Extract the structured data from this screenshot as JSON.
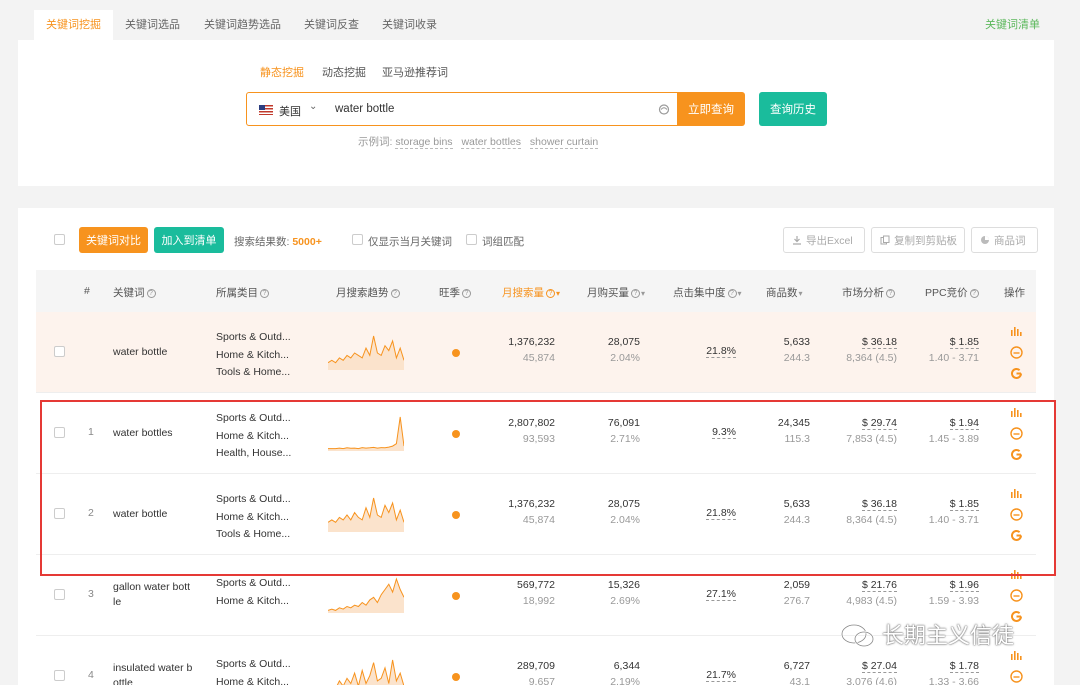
{
  "top_tabs": [
    "关键词挖掘",
    "关键词选品",
    "关键词趋势选品",
    "关键词反查",
    "关键词收录"
  ],
  "keyword_list_link": "关键词清单",
  "search": {
    "mode_tabs": [
      "静态挖掘",
      "动态挖掘",
      "亚马逊推荐词"
    ],
    "country": "美国",
    "query": "water bottle",
    "query_button": "立即查询",
    "history_button": "查询历史",
    "examples_label": "示例词:",
    "examples": [
      "storage bins",
      "water bottles",
      "shower curtain"
    ]
  },
  "toolbar": {
    "compare_button": "关键词对比",
    "add_list_button": "加入到清单",
    "result_label": "搜索结果数:",
    "result_count": "5000+",
    "option_current_month": "仅显示当月关键词",
    "option_phrase_match": "词组匹配",
    "export_excel": "导出Excel",
    "copy_clipboard": "复制到剪贴板",
    "product_words": "商品词"
  },
  "columns": {
    "index": "#",
    "keyword": "关键词",
    "category": "所属类目",
    "trend": "月搜索趋势",
    "wangshou": "旺季",
    "monthly_search": "月搜索量",
    "monthly_purchase": "月购买量",
    "click_concentration": "点击集中度",
    "product_count": "商品数",
    "market_analysis": "市场分析",
    "ppc_bid": "PPC竞价",
    "actions": "操作"
  },
  "rows": [
    {
      "index": "",
      "keyword": "water bottle",
      "categories": [
        "Sports & Outd...",
        "Home & Kitch...",
        "Tools & Home..."
      ],
      "search": "1,376,232",
      "search_sub": "45,874",
      "purchase": "28,075",
      "purchase_sub": "2.04%",
      "click": "21.8%",
      "products": "5,633",
      "products_sub": "244.3",
      "price": "$ 36.18",
      "rating": "8,364 (4.5)",
      "ppc": "$ 1.85",
      "ppc_range": "1.40 - 3.71",
      "trend": [
        3,
        4,
        3,
        5,
        4,
        6,
        5,
        7,
        6,
        5,
        9,
        6,
        14,
        7,
        6,
        10,
        8,
        12,
        5,
        9,
        4
      ]
    },
    {
      "index": "1",
      "keyword": "water bottles",
      "categories": [
        "Sports & Outd...",
        "Home & Kitch...",
        "Health, House..."
      ],
      "search": "2,807,802",
      "search_sub": "93,593",
      "purchase": "76,091",
      "purchase_sub": "2.71%",
      "click": "9.3%",
      "products": "24,345",
      "products_sub": "115.3",
      "price": "$ 29.74",
      "rating": "7,853 (4.5)",
      "ppc": "$ 1.94",
      "ppc_range": "1.45 - 3.89",
      "trend": [
        1,
        1,
        1,
        1.2,
        1,
        1.3,
        1.1,
        1.2,
        1,
        1.4,
        1.2,
        1.3,
        1.5,
        1.2,
        1.4,
        1.3,
        1.6,
        2,
        3,
        14,
        2
      ]
    },
    {
      "index": "2",
      "keyword": "water bottle",
      "categories": [
        "Sports & Outd...",
        "Home & Kitch...",
        "Tools & Home..."
      ],
      "search": "1,376,232",
      "search_sub": "45,874",
      "purchase": "28,075",
      "purchase_sub": "2.04%",
      "click": "21.8%",
      "products": "5,633",
      "products_sub": "244.3",
      "price": "$ 36.18",
      "rating": "8,364 (4.5)",
      "ppc": "$ 1.85",
      "ppc_range": "1.40 - 3.71",
      "trend": [
        4,
        5,
        4,
        6,
        5,
        7,
        5,
        8,
        6,
        5,
        10,
        6,
        14,
        7,
        6,
        11,
        8,
        12,
        5,
        9,
        4
      ]
    },
    {
      "index": "3",
      "keyword": "gallon water bott\nle",
      "categories": [
        "Sports & Outd...",
        "Home & Kitch..."
      ],
      "search": "569,772",
      "search_sub": "18,992",
      "purchase": "15,326",
      "purchase_sub": "2.69%",
      "click": "27.1%",
      "products": "2,059",
      "products_sub": "276.7",
      "price": "$ 21.76",
      "rating": "4,983 (4.5)",
      "ppc": "$ 1.96",
      "ppc_range": "1.59 - 3.93",
      "trend": [
        1,
        1.5,
        1,
        2,
        1.5,
        2.5,
        2,
        3,
        2.5,
        4,
        3,
        5,
        6,
        4,
        7,
        9,
        11,
        8,
        13,
        9,
        6
      ]
    },
    {
      "index": "4",
      "keyword": "insulated water b\nottle",
      "categories": [
        "Sports & Outd...",
        "Home & Kitch..."
      ],
      "search": "289,709",
      "search_sub": "9,657",
      "purchase": "6,344",
      "purchase_sub": "2.19%",
      "click": "21.7%",
      "products": "6,727",
      "products_sub": "43.1",
      "price": "$ 27.04",
      "rating": "3,076 (4.6)",
      "ppc": "$ 1.78",
      "ppc_range": "1.33 - 3.66",
      "trend": [
        2,
        3,
        2,
        5,
        3,
        6,
        4,
        8,
        3,
        9,
        4,
        7,
        12,
        5,
        6,
        10,
        4,
        13,
        5,
        8,
        3
      ]
    }
  ],
  "watermark": "长期主义信徒",
  "colors": {
    "accent": "#f7931e",
    "teal": "#1abc9c",
    "highlight_frame": "#e53935",
    "list_link": "#5cb85c"
  }
}
